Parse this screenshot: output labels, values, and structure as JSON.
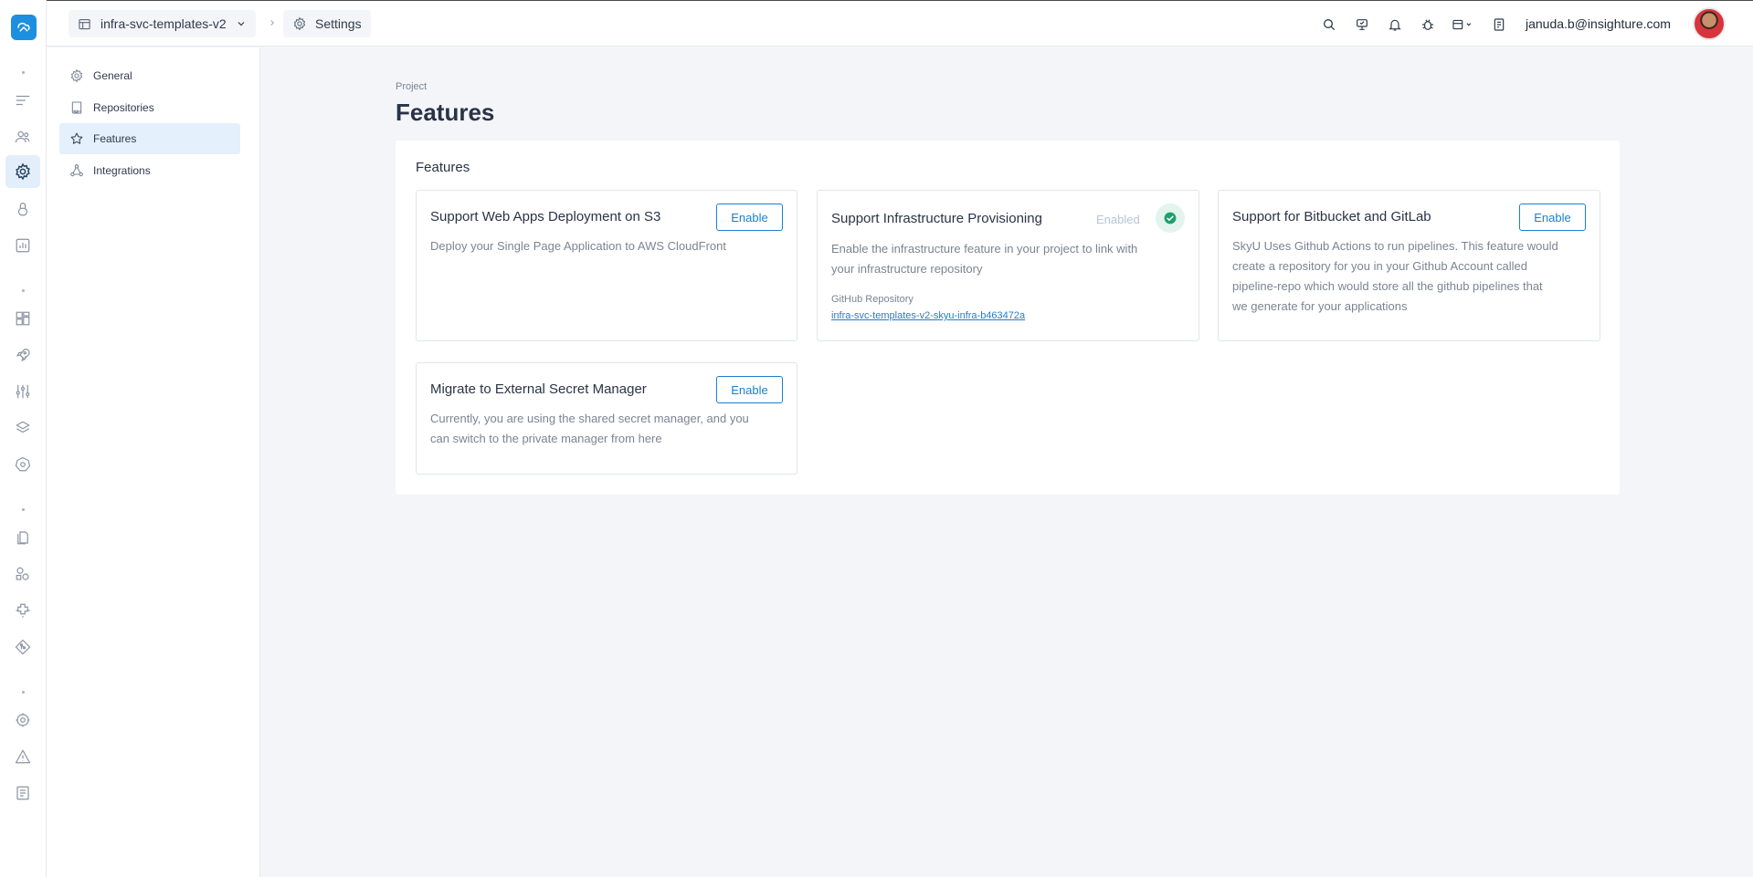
{
  "topbar": {
    "project_name": "infra-svc-templates-v2",
    "breadcrumb_current": "Settings",
    "user_email": "januda.b@insighture.com"
  },
  "subnav": {
    "items": [
      {
        "label": "General",
        "icon": "gear-icon"
      },
      {
        "label": "Repositories",
        "icon": "repository-icon"
      },
      {
        "label": "Features",
        "icon": "star-icon",
        "active": true
      },
      {
        "label": "Integrations",
        "icon": "integrations-icon"
      }
    ]
  },
  "page": {
    "eyebrow": "Project",
    "title": "Features"
  },
  "panel": {
    "title": "Features",
    "cards": [
      {
        "title": "Support Web Apps Deployment on S3",
        "description": "Deploy your Single Page Application to AWS CloudFront",
        "action": "Enable"
      },
      {
        "title": "Support Infrastructure Provisioning",
        "status": "Enabled",
        "description_line1": "Enable the infrastructure feature in your project to link with",
        "description_line2": "your infrastructure repository",
        "repo_label": "GitHub Repository",
        "repo_link": "infra-svc-templates-v2-skyu-infra-b463472a"
      },
      {
        "title": "Support for Bitbucket and GitLab",
        "description_line1": "SkyU Uses Github Actions to run pipelines. This feature would",
        "description_line2": "create a repository for you in your Github Account called",
        "description_line3": "pipeline-repo which would store all the github pipelines that",
        "description_line4": "we generate for your applications",
        "action": "Enable"
      },
      {
        "title": "Migrate to External Secret Manager",
        "description_line1": "Currently, you are using the shared secret manager, and you",
        "description_line2": "can switch to the private manager from here",
        "action": "Enable"
      }
    ]
  },
  "colors": {
    "accent": "#1c7fd0",
    "logo": "#1c8fe0",
    "active_nav_bg": "#e4f0fb",
    "success": "#1f9e6e",
    "page_bg": "#f3f5f8"
  }
}
